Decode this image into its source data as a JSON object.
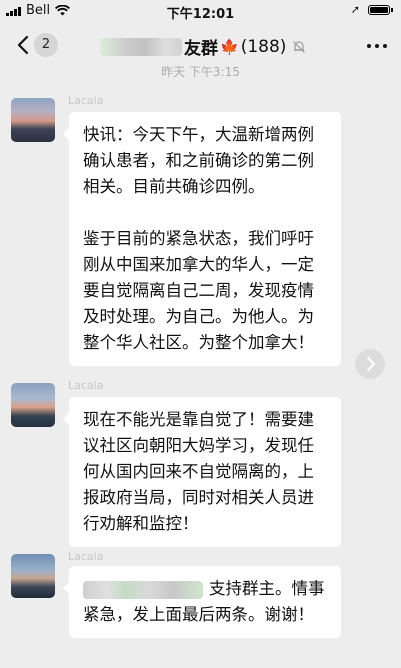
{
  "status_bar": {
    "carrier": "Bell",
    "time": "下午12:01"
  },
  "nav": {
    "back_count": "2",
    "group_suffix": "友群",
    "member_count": "(188)"
  },
  "timestamp": "昨天 下午3:15",
  "messages": [
    {
      "sender": "Lacala",
      "paragraphs": [
        "快讯：今天下午，大温新增两例确认患者，和之前确诊的第二例相关。目前共确诊四例。",
        "鉴于目前的紧急状态，我们呼吁刚从中国来加拿大的华人，一定要自觉隔离自己二周，发现疫情及时处理。为自己。为他人。为整个华人社区。为整个加拿大！"
      ]
    },
    {
      "sender": "Lacala",
      "paragraphs": [
        "现在不能光是靠自觉了！需要建议社区向朝阳大妈学习，发现任何从国内回来不自觉隔离的，上报政府当局，同时对相关人员进行劝解和监控！"
      ]
    },
    {
      "sender": "Lacala",
      "paragraphs": [
        "支持群主。情事紧急，发上面最后两条。谢谢！"
      ]
    }
  ],
  "colors": {
    "chat_bg": "#ededed",
    "bubble": "#ffffff",
    "maple": "#c0442a"
  }
}
